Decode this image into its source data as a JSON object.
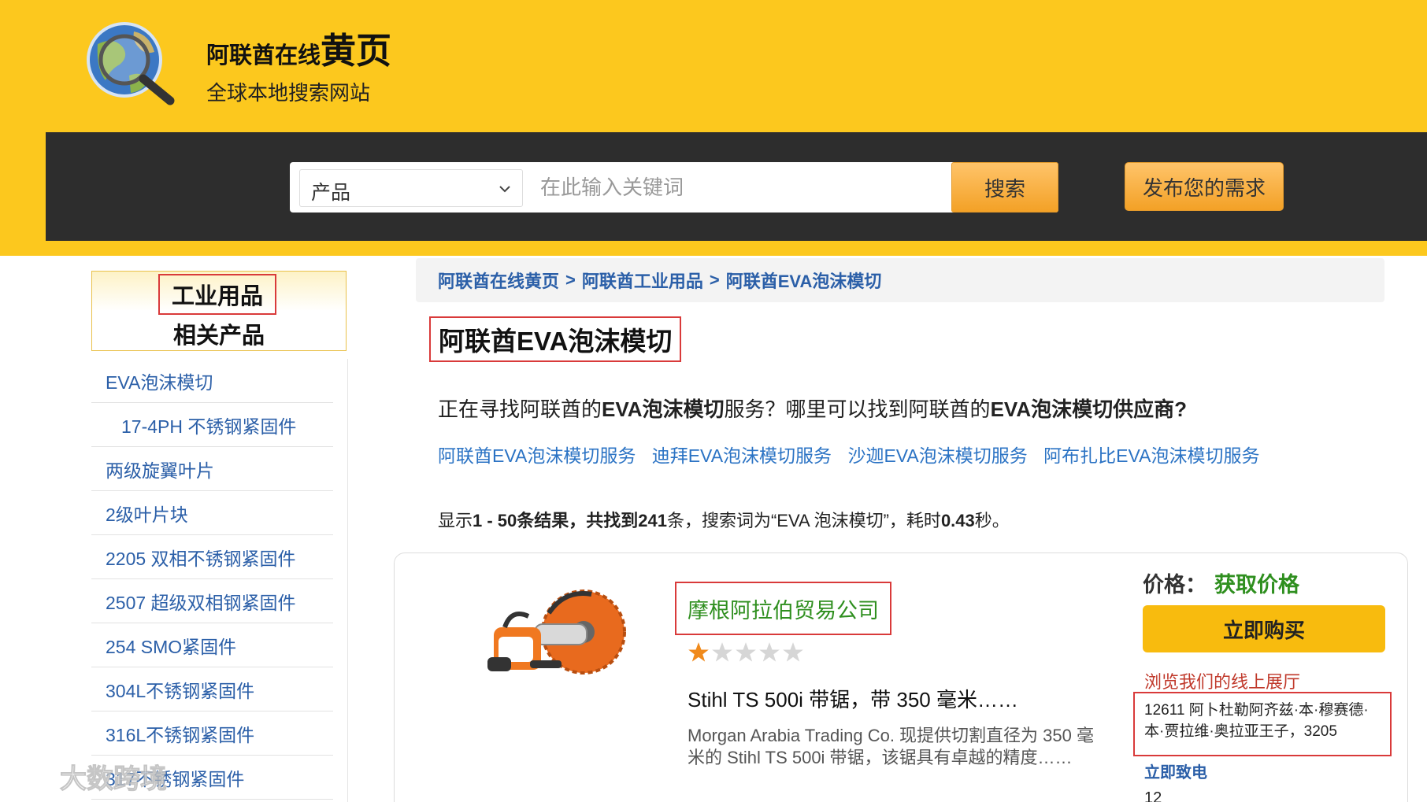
{
  "header": {
    "title_prefix": "阿联酋在线",
    "title_big": "黄页",
    "subtitle": "全球本地搜索网站"
  },
  "search": {
    "category": "产品",
    "placeholder": "在此输入关键词",
    "button": "搜索",
    "post_button": "发布您的需求"
  },
  "sidebar": {
    "heading_1": "工业用品",
    "heading_2": "相关产品",
    "items": [
      {
        "label": "EVA泡沫模切"
      },
      {
        "label": "17-4PH 不锈钢紧固件"
      },
      {
        "label": "两级旋翼叶片"
      },
      {
        "label": "2级叶片块"
      },
      {
        "label": "2205 双相不锈钢紧固件"
      },
      {
        "label": "2507 超级双相钢紧固件"
      },
      {
        "label": "254 SMO紧固件"
      },
      {
        "label": "304L不锈钢紧固件"
      },
      {
        "label": "316L不锈钢紧固件"
      },
      {
        "label": "317不锈钢紧固件"
      }
    ]
  },
  "breadcrumb": {
    "items": [
      "阿联酋在线黄页",
      "阿联酋工业用品",
      "阿联酋EVA泡沫模切"
    ],
    "separator": ">"
  },
  "main": {
    "page_title": "阿联酋EVA泡沫模切",
    "question_1": "正在寻找阿联酋的",
    "question_b1": "EVA泡沫模切",
    "question_2": "服务？哪里可以找到阿联酋的",
    "question_b2": "EVA泡沫模切供应商?",
    "links": [
      "阿联酋EVA泡沫模切服务",
      "迪拜EVA泡沫模切服务",
      "沙迦EVA泡沫模切服务",
      "阿布扎比EVA泡沫模切服务"
    ],
    "results_1": "显示",
    "results_b1": "1 - 50条结果，共找到241",
    "results_2": "条，搜索词为“EVA 泡沫模切”，耗时",
    "results_b2": "0.43",
    "results_3": "秒。"
  },
  "product": {
    "company": "摩根阿拉伯贸易公司",
    "rating": 1,
    "rating_max": 5,
    "title": "Stihl TS 500i 带锯，带 350 毫米……",
    "description": "Morgan Arabia Trading Co. 现提供切割直径为 350 毫米的 Stihl TS 500i 带锯，该锯具有卓越的精度……",
    "price_label": "价格：",
    "price_value": "获取价格",
    "buy_button": "立即购买",
    "showroom": "浏览我们的线上展厅",
    "address": "12611 阿卜杜勒阿齐兹·本·穆赛德·本·贾拉维·奥拉亚王子，3205",
    "call": "立即致电",
    "number": "12"
  },
  "watermark": {
    "text": "大数跨境"
  },
  "colors": {
    "header_bg": "#fcc81e",
    "searchbar_bg": "#2d2d2d",
    "link_blue": "#2b5fa8",
    "green": "#2f8f1f",
    "highlight_red": "#d93a3a"
  },
  "icons": [
    "globe-magnifier-logo",
    "chevron-down-icon",
    "star-icon",
    "saw-product-image",
    "watermark-logo"
  ]
}
